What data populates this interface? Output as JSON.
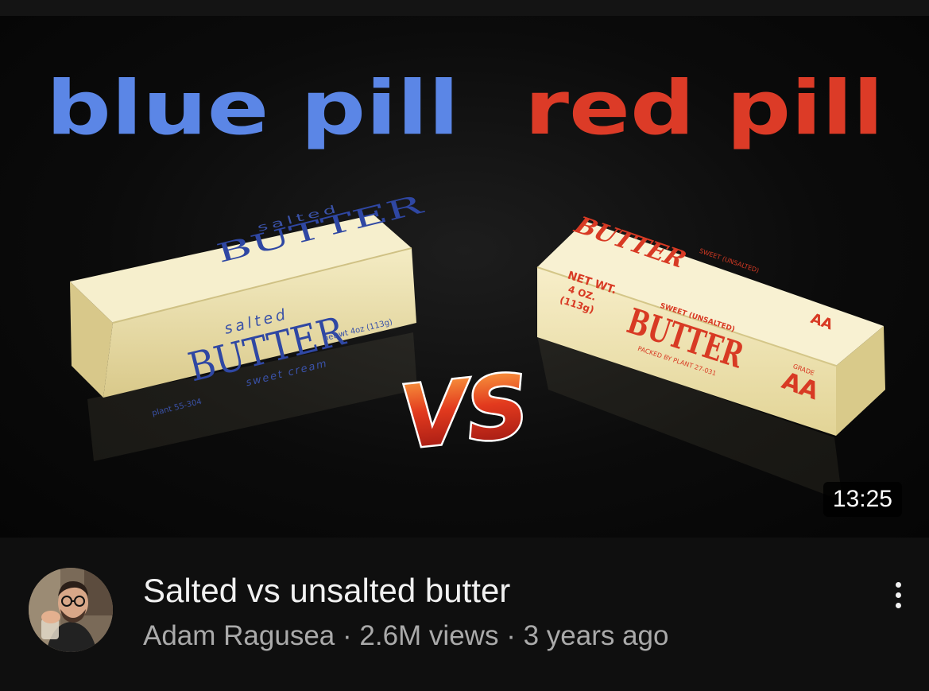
{
  "video": {
    "thumbnail": {
      "headline_left": "blue pill",
      "headline_right": "red pill",
      "versus_text": "VS",
      "left_stick": {
        "top_small": "salted",
        "top_big": "BUTTER",
        "main_small": "salted",
        "main_big": "BUTTER",
        "sub": "sweet cream",
        "side": "net wt 4oz (113g)",
        "bottom": "plant 55-304"
      },
      "right_stick": {
        "net_wt": [
          "NET WT.",
          "4 OZ.",
          "(113g)"
        ],
        "top_big": "BUTTER",
        "top_sub": "SWEET (UNSALTED)",
        "main_sub": "SWEET (UNSALTED)",
        "main_big": "BUTTER",
        "packed": "PACKED BY PLANT 27-031",
        "grade_label": "GRADE",
        "grade": "AA"
      },
      "colors": {
        "blue": "#5b86e6",
        "red": "#dc3b27",
        "butter": "#efe4b0",
        "background": "#0a0a0a"
      }
    },
    "duration": "13:25",
    "title": "Salted vs unsalted butter",
    "channel": "Adam Ragusea",
    "views": "2.6M views",
    "age": "3 years ago",
    "separator": "·",
    "more_icon": "vertical-dots-icon"
  }
}
